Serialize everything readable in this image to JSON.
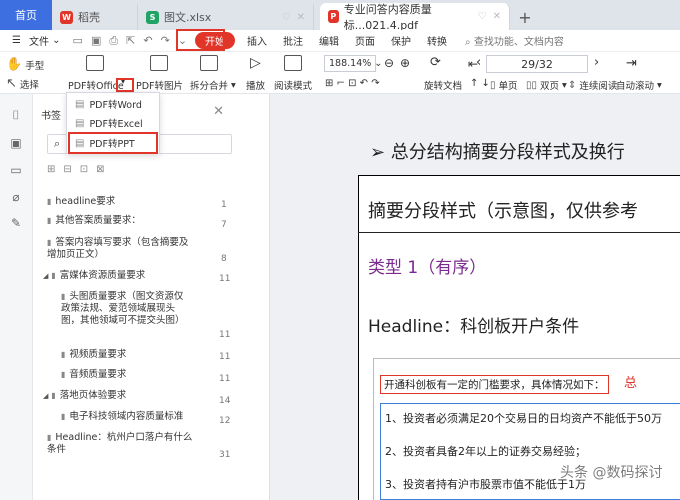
{
  "tabs": {
    "home": "首页",
    "daoke": "稻壳",
    "xlsx": "图文.xlsx",
    "pdf": "专业问答内容质量标...021.4.pdf",
    "close": "✕",
    "plus": "+"
  },
  "menu": {
    "file": "文件",
    "start": "开始",
    "insert": "插入",
    "annotate": "批注",
    "edit": "编辑",
    "page": "页面",
    "protect": "保护",
    "convert": "转换",
    "search": "查找功能、文档内容"
  },
  "toolbar": {
    "hand": "手型",
    "select": "选择",
    "pdf_to_office": "PDF转Office",
    "pdf_to_image": "PDF转图片",
    "split_merge": "拆分合并",
    "play": "播放",
    "read_mode": "阅读模式",
    "zoom": "188.14%",
    "rotate": "旋转文档",
    "page_indicator": "29/32",
    "single": "单页",
    "double": "双页",
    "continuous": "连续阅读",
    "auto_scroll": "自动滚动"
  },
  "dropdown": {
    "items": [
      "PDF转Word",
      "PDF转Excel",
      "PDF转PPT"
    ]
  },
  "panel": {
    "title": "书签",
    "close": "✕",
    "items": [
      {
        "label": "headline要求",
        "page": "1"
      },
      {
        "label": "其他答案质量要求：",
        "page": "7"
      },
      {
        "label": "答案内容填写要求（包含摘要及增加页正文）",
        "page": "8"
      },
      {
        "label": "富媒体资源质量要求",
        "page": "11"
      },
      {
        "label": "头图质量要求（图文资源仅政策法规、爱范领域展现头图，其他领域可不提交头图）",
        "page": "11"
      },
      {
        "label": "视频质量要求",
        "page": "11"
      },
      {
        "label": "音频质量要求",
        "page": "11"
      },
      {
        "label": "落地页体验要求",
        "page": "14"
      },
      {
        "label": "电子科技领域内容质量标准",
        "page": "12"
      },
      {
        "label": "Headline：杭州户口落户有什么条件",
        "page": "31"
      }
    ]
  },
  "document": {
    "heading": "➢  总分结构摘要分段样式及换行",
    "title": "摘要分段样式（示意图，仅供参考",
    "type1": "类型 1（有序）",
    "headline": "Headline：科创板开户条件",
    "requirement": "开通科创板有一定的门槛要求，具体情况如下：",
    "req_mark": "总",
    "list": [
      "1、投资者必须满足20个交易日的日均资产不能低于50万",
      "2、投资者具备2年以上的证券交易经验；",
      "3、投资者持有沪市股票市值不能低于1万"
    ],
    "watermark": "头条 @数码探讨"
  }
}
